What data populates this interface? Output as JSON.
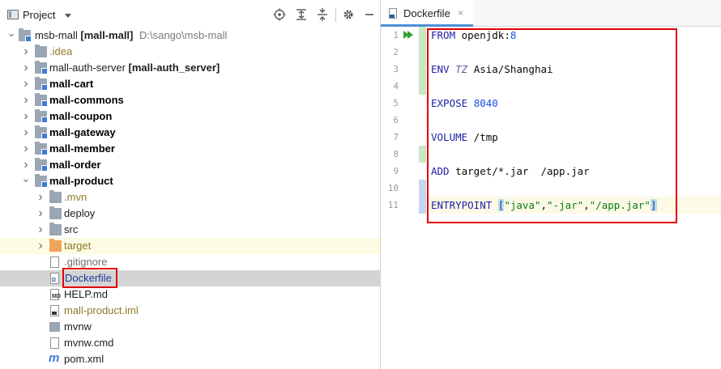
{
  "project_panel": {
    "title": "Project",
    "header_icons": [
      "locate-icon",
      "expand-all-icon",
      "collapse-all-icon",
      "settings-icon",
      "hide-icon"
    ],
    "root": {
      "name": "msb-mall",
      "module": "[mall-mall]",
      "path": "D:\\sango\\msb-mall"
    },
    "items": [
      {
        "label": ".idea"
      },
      {
        "label": "mall-auth-server",
        "module": "[mall-auth_server]"
      },
      {
        "label": "mall-cart"
      },
      {
        "label": "mall-commons"
      },
      {
        "label": "mall-coupon"
      },
      {
        "label": "mall-gateway"
      },
      {
        "label": "mall-member"
      },
      {
        "label": "mall-order"
      },
      {
        "label": "mall-product"
      },
      {
        "label": ".mvn"
      },
      {
        "label": "deploy"
      },
      {
        "label": "src"
      },
      {
        "label": "target"
      },
      {
        "label": ".gitignore"
      },
      {
        "label": "Dockerfile"
      },
      {
        "label": "HELP.md"
      },
      {
        "label": "mall-product.iml"
      },
      {
        "label": "mvnw"
      },
      {
        "label": "mvnw.cmd"
      },
      {
        "label": "pom.xml"
      }
    ]
  },
  "editor": {
    "tab_label": "Dockerfile",
    "tab_close": "×",
    "line_numbers": [
      "1",
      "2",
      "3",
      "4",
      "5",
      "6",
      "7",
      "8",
      "9",
      "10",
      "11"
    ],
    "code": {
      "l1_kw": "FROM",
      "l1_rest": " openjdk:",
      "l1_num": "8",
      "l3_kw": "ENV",
      "l3_var": "TZ",
      "l3_rest": " Asia/Shanghai",
      "l5_kw": "EXPOSE",
      "l5_num": "8040",
      "l7_kw": "VOLUME",
      "l7_rest": " /tmp",
      "l9_kw": "ADD",
      "l9_rest": " target/*.jar  /app.jar",
      "l11_kw": "ENTRYPOINT",
      "l11_open": "[",
      "l11_s1": "\"java\"",
      "l11_c1": ",",
      "l11_s2": "\"-jar\"",
      "l11_c2": ",",
      "l11_s3": "\"/app.jar\"",
      "l11_close": "]"
    }
  },
  "colors": {
    "selection": "#d4d4d4",
    "highlight_row": "#fdfbe3",
    "red_box": "#e00000",
    "keyword": "#1f1fa6",
    "string": "#0a7a14",
    "tab_accent": "#4b8fd5"
  }
}
